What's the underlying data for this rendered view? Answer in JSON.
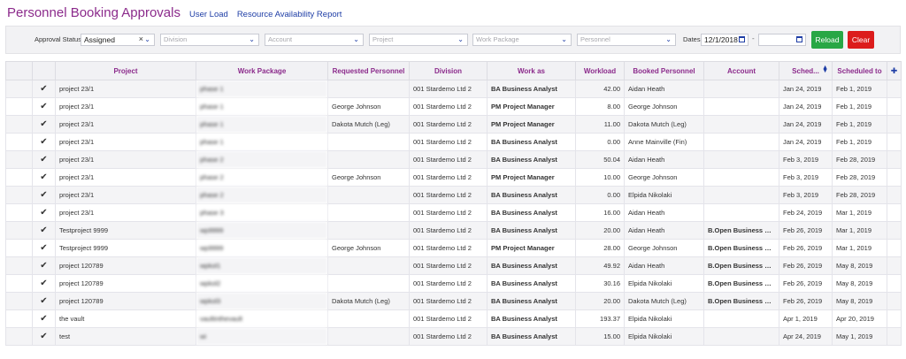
{
  "header": {
    "title": "Personnel Booking Approvals",
    "links": [
      "User Load",
      "Resource Availability Report"
    ]
  },
  "filters": {
    "approval_status_label": "Approval Status",
    "approval_status_value": "Assigned",
    "division_placeholder": "Division",
    "account_placeholder": "Account",
    "project_placeholder": "Project",
    "work_package_placeholder": "Work Package",
    "personnel_placeholder": "Personnel",
    "dates_label": "Dates",
    "date_from": "12/1/2018",
    "date_separator": "-",
    "reload_label": "Reload",
    "clear_label": "Clear"
  },
  "table": {
    "columns": [
      "Project",
      "Work Package",
      "Requested Personnel",
      "Division",
      "Work as",
      "Workload",
      "Booked Personnel",
      "Account",
      "Sched...",
      "Scheduled to"
    ],
    "rows": [
      {
        "project": "project 23/1",
        "work_package": "phase 1",
        "requested": "",
        "division": "001 Stardemo Ltd 2",
        "work_as": "BA Business Analyst",
        "workload": "42.00",
        "booked": "Aidan Heath",
        "account": "",
        "sched_from": "Jan 24, 2019",
        "sched_to": "Feb 1, 2019"
      },
      {
        "project": "project 23/1",
        "work_package": "phase 1",
        "requested": "George Johnson",
        "division": "001 Stardemo Ltd 2",
        "work_as": "PM Project Manager",
        "workload": "8.00",
        "booked": "George Johnson",
        "account": "",
        "sched_from": "Jan 24, 2019",
        "sched_to": "Feb 1, 2019"
      },
      {
        "project": "project 23/1",
        "work_package": "phase 1",
        "requested": "Dakota Mutch (Leg)",
        "division": "001 Stardemo Ltd 2",
        "work_as": "PM Project Manager",
        "workload": "11.00",
        "booked": "Dakota Mutch (Leg)",
        "account": "",
        "sched_from": "Jan 24, 2019",
        "sched_to": "Feb 1, 2019"
      },
      {
        "project": "project 23/1",
        "work_package": "phase 1",
        "requested": "",
        "division": "001 Stardemo Ltd 2",
        "work_as": "BA Business Analyst",
        "workload": "0.00",
        "booked": "Anne Mainville (Fin)",
        "account": "",
        "sched_from": "Jan 24, 2019",
        "sched_to": "Feb 1, 2019"
      },
      {
        "project": "project 23/1",
        "work_package": "phase 2",
        "requested": "",
        "division": "001 Stardemo Ltd 2",
        "work_as": "BA Business Analyst",
        "workload": "50.04",
        "booked": "Aidan Heath",
        "account": "",
        "sched_from": "Feb 3, 2019",
        "sched_to": "Feb 28, 2019"
      },
      {
        "project": "project 23/1",
        "work_package": "phase 2",
        "requested": "George Johnson",
        "division": "001 Stardemo Ltd 2",
        "work_as": "PM Project Manager",
        "workload": "10.00",
        "booked": "George Johnson",
        "account": "",
        "sched_from": "Feb 3, 2019",
        "sched_to": "Feb 28, 2019"
      },
      {
        "project": "project 23/1",
        "work_package": "phase 2",
        "requested": "",
        "division": "001 Stardemo Ltd 2",
        "work_as": "BA Business Analyst",
        "workload": "0.00",
        "booked": "Elpida Nikolaki",
        "account": "",
        "sched_from": "Feb 3, 2019",
        "sched_to": "Feb 28, 2019"
      },
      {
        "project": "project 23/1",
        "work_package": "phase 3",
        "requested": "",
        "division": "001 Stardemo Ltd 2",
        "work_as": "BA Business Analyst",
        "workload": "16.00",
        "booked": "Aidan Heath",
        "account": "",
        "sched_from": "Feb 24, 2019",
        "sched_to": "Mar 1, 2019"
      },
      {
        "project": "Testproject 9999",
        "work_package": "wp9999",
        "requested": "",
        "division": "001 Stardemo Ltd 2",
        "work_as": "BA Business Analyst",
        "workload": "20.00",
        "booked": "Aidan Heath",
        "account": "B.Open Business Ope...",
        "sched_from": "Feb 26, 2019",
        "sched_to": "Mar 1, 2019"
      },
      {
        "project": "Testproject 9999",
        "work_package": "wp9999",
        "requested": "George Johnson",
        "division": "001 Stardemo Ltd 2",
        "work_as": "PM Project Manager",
        "workload": "28.00",
        "booked": "George Johnson",
        "account": "B.Open Business Ope...",
        "sched_from": "Feb 26, 2019",
        "sched_to": "Mar 1, 2019"
      },
      {
        "project": "project 120789",
        "work_package": "wpkol1",
        "requested": "",
        "division": "001 Stardemo Ltd 2",
        "work_as": "BA Business Analyst",
        "workload": "49.92",
        "booked": "Aidan Heath",
        "account": "B.Open Business Ope...",
        "sched_from": "Feb 26, 2019",
        "sched_to": "May 8, 2019"
      },
      {
        "project": "project 120789",
        "work_package": "wpkol2",
        "requested": "",
        "division": "001 Stardemo Ltd 2",
        "work_as": "BA Business Analyst",
        "workload": "30.16",
        "booked": "Elpida Nikolaki",
        "account": "B.Open Business Ope...",
        "sched_from": "Feb 26, 2019",
        "sched_to": "May 8, 2019"
      },
      {
        "project": "project 120789",
        "work_package": "wpkol3",
        "requested": "Dakota Mutch (Leg)",
        "division": "001 Stardemo Ltd 2",
        "work_as": "BA Business Analyst",
        "workload": "20.00",
        "booked": "Dakota Mutch (Leg)",
        "account": "B.Open Business Ope...",
        "sched_from": "Feb 26, 2019",
        "sched_to": "May 8, 2019"
      },
      {
        "project": "the vault",
        "work_package": "vaultinthevault",
        "requested": "",
        "division": "001 Stardemo Ltd 2",
        "work_as": "BA Business Analyst",
        "workload": "193.37",
        "booked": "Elpida Nikolaki",
        "account": "",
        "sched_from": "Apr 1, 2019",
        "sched_to": "Apr 20, 2019"
      },
      {
        "project": "test",
        "work_package": "wi",
        "requested": "",
        "division": "001 Stardemo Ltd 2",
        "work_as": "BA Business Analyst",
        "workload": "15.00",
        "booked": "Elpida Nikolaki",
        "account": "",
        "sched_from": "Apr 24, 2019",
        "sched_to": "May 1, 2019"
      }
    ]
  },
  "icons": {
    "check": "checkmark-icon",
    "sort": "sort-icon",
    "pin": "pin-icon",
    "calendar": "calendar-icon",
    "chevron": "chevron-down-icon"
  },
  "colors": {
    "title": "#8b2a8b",
    "link": "#1f3ea6",
    "reload": "#28a745",
    "clear": "#dc1c1c",
    "check": "#1aa53a"
  }
}
